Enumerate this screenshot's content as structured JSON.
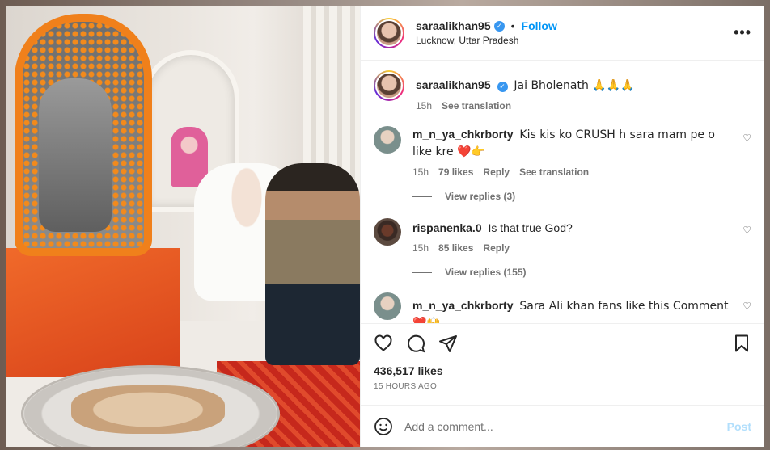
{
  "post": {
    "username": "saraalikhan95",
    "follow_label": "Follow",
    "separator": "•",
    "location": "Lucknow, Uttar Pradesh",
    "more_label": "•••"
  },
  "caption": {
    "username": "saraalikhan95",
    "text": "Jai Bholenath 🙏🙏🙏",
    "age": "15h",
    "see_translation": "See translation"
  },
  "comments": [
    {
      "username": "m_n_ya_chkrborty",
      "text": "Kis kis ko CRUSH h sara mam pe o like kre ❤️👉",
      "age": "15h",
      "likes": "79 likes",
      "reply": "Reply",
      "see_translation": "See translation",
      "view_replies": "View replies (3)"
    },
    {
      "username": "rispanenka.0",
      "text": "Is that true God?",
      "age": "15h",
      "likes": "85 likes",
      "reply": "Reply",
      "view_replies": "View replies (155)"
    },
    {
      "username": "m_n_ya_chkrborty",
      "text": "Sara Ali khan fans like this Comment ❤️🙌"
    }
  ],
  "stats": {
    "likes": "436,517 likes",
    "time": "15 HOURS AGO"
  },
  "composer": {
    "placeholder": "Add a comment...",
    "post_label": "Post"
  },
  "colors": {
    "accent": "#0095f6",
    "verified": "#3897f0",
    "post_disabled": "#b2dffc"
  }
}
